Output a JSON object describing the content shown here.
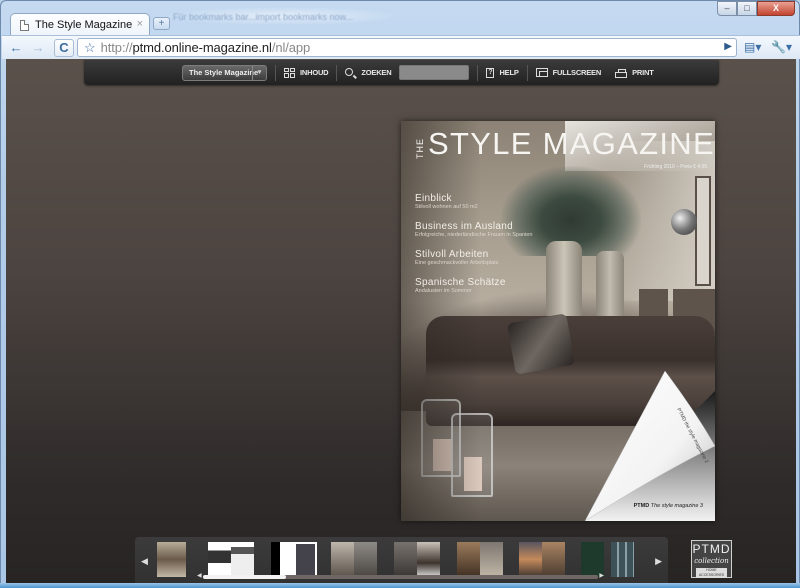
{
  "browser": {
    "tab": {
      "title": "The Style Magazine",
      "close": "×",
      "icon": "page-icon"
    },
    "new_tab": "+",
    "ghost_text": "Für bookmarks bar...import bookmarks now...",
    "window_controls": {
      "minimize": "–",
      "maximize": "□",
      "close": "X"
    },
    "nav": {
      "back": "←",
      "forward": "→",
      "reload": "C",
      "star": "☆"
    },
    "url_scheme": "http://",
    "url_host": "ptmd.online-magazine.nl",
    "url_path": "/nl/app",
    "go": "▶",
    "page_menu": "▤▾",
    "wrench_menu": "🔧▾"
  },
  "magazine_toolbar": {
    "issue_select": {
      "value": "The Style Magazine",
      "caret": "▾"
    },
    "contents_label": "INHOUD",
    "search_label": "ZOEKEN",
    "search_value": "",
    "help_label": "HELP",
    "help_glyph": "?",
    "fullscreen_label": "FULLSCREEN",
    "print_label": "PRINT"
  },
  "cover": {
    "the": "THE",
    "title": "STYLE MAGAZINE",
    "issue": "Frühling 2010 – Preis € 4,95",
    "headlines": [
      {
        "title": "Einblick",
        "sub": "Stilvoll wohnen auf 50 m2"
      },
      {
        "title": "Business im Ausland",
        "sub": "Erfolgreiche, niederländische Frauen in Spanien"
      },
      {
        "title": "Stilvoll Arbeiten",
        "sub": "Eine geschmackvoller Arbeitsplatz"
      },
      {
        "title": "Spanische Schätze",
        "sub": "Andalusien im Sommer"
      }
    ],
    "curl_text": "PTMD the style magazine 2",
    "footer_brand": "PTMD",
    "footer_text": "The style magazine 3"
  },
  "thumbnails": {
    "prev": "◀",
    "next": "▶",
    "pages": [
      {
        "name": "cover"
      },
      {
        "name": "page-2-3"
      },
      {
        "name": "page-4-5"
      },
      {
        "name": "page-6-7"
      },
      {
        "name": "page-8-9"
      },
      {
        "name": "page-10-11"
      },
      {
        "name": "page-12-13"
      },
      {
        "name": "page-14"
      },
      {
        "name": "back-cover"
      }
    ],
    "scroll_position": 0.21
  },
  "logo": {
    "line1": "PTMD",
    "line2": "collection",
    "line3": "HOME ACCESSORIES"
  }
}
